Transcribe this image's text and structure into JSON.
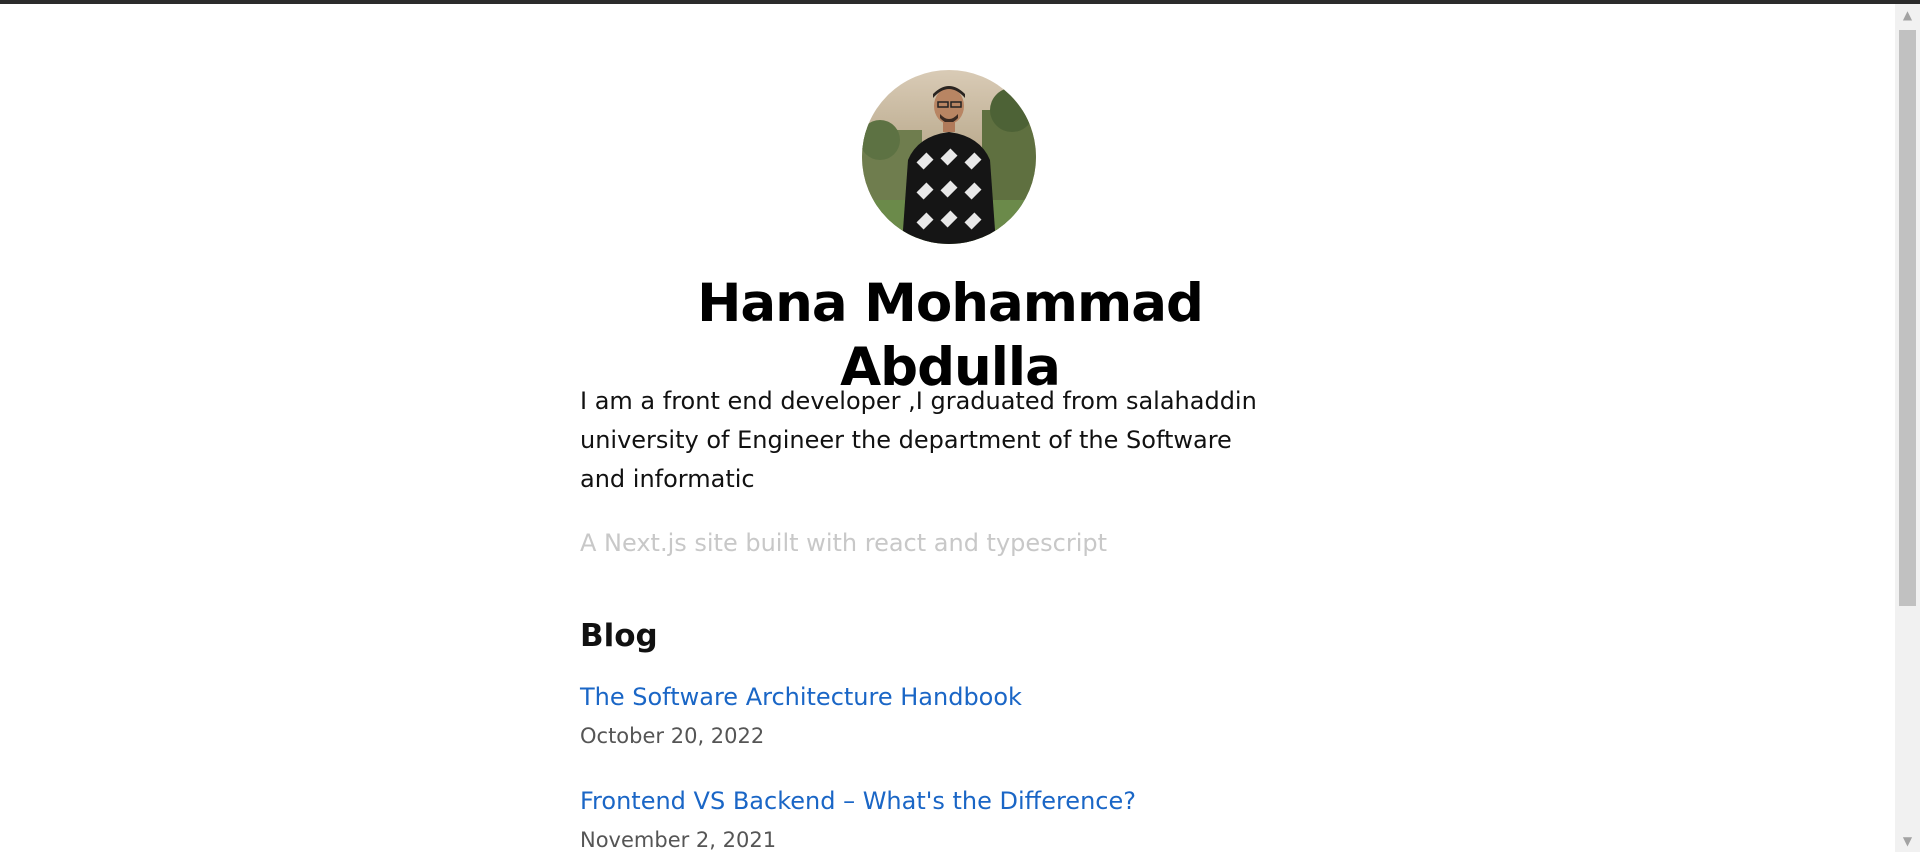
{
  "profile": {
    "name": "Hana Mohammad Abdulla",
    "intro": "I am a front end developer ,I graduated from salahaddin university of Engineer the department of the Software and informatic",
    "tagline": "A Next.js site built with react and typescript"
  },
  "blog": {
    "heading": "Blog",
    "posts": [
      {
        "title": "The Software Architecture Handbook",
        "date": "October 20, 2022"
      },
      {
        "title": "Frontend VS Backend – What's the Difference?",
        "date": "November 2, 2021"
      }
    ]
  },
  "colors": {
    "link": "#1a66c6",
    "muted": "#c8c8c8",
    "date": "#555555",
    "top_bar": "#2b2b2b"
  },
  "icons": {
    "scroll_up": "scroll-up-arrow-icon",
    "scroll_down": "scroll-down-arrow-icon"
  }
}
